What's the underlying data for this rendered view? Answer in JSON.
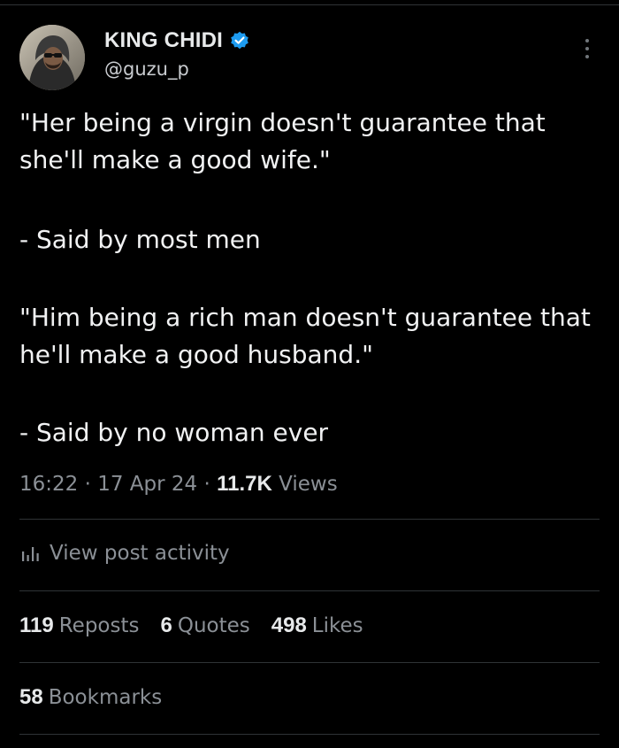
{
  "author": {
    "name": "KING CHIDI",
    "handle": "@guzu_p",
    "verified": true
  },
  "tweet": {
    "paragraphs": [
      "\"Her being a virgin doesn't guarantee that she'll make a good wife.\"",
      "- Said by most men",
      "\"Him being a rich man doesn't guarantee that he'll make a good husband.\"",
      "- Said by no woman ever"
    ]
  },
  "meta": {
    "time": "16:22",
    "dot1": "·",
    "date": "17 Apr 24",
    "dot2": "·",
    "views_count": "11.7K",
    "views_label": "Views"
  },
  "activity": {
    "label": "View post activity",
    "icon": "bar-chart-icon"
  },
  "stats": {
    "reposts": {
      "count": "119",
      "label": "Reposts"
    },
    "quotes": {
      "count": "6",
      "label": "Quotes"
    },
    "likes": {
      "count": "498",
      "label": "Likes"
    },
    "bookmarks": {
      "count": "58",
      "label": "Bookmarks"
    }
  },
  "colors": {
    "background": "#000000",
    "text": "#e7e9ea",
    "muted": "#8b9096",
    "divider": "#2f3336",
    "verified": "#1d9bf0"
  }
}
